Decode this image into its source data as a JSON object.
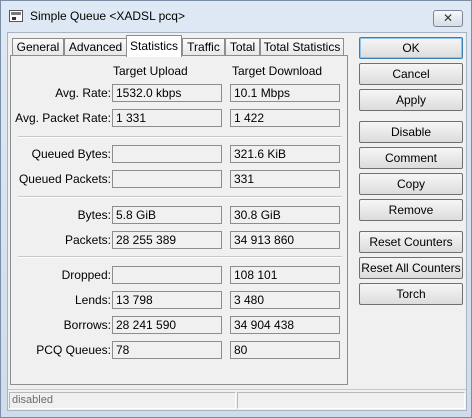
{
  "window": {
    "title": "Simple Queue <XADSL pcq>",
    "close_glyph": "✕"
  },
  "tabs": [
    {
      "label": "General",
      "active": false
    },
    {
      "label": "Advanced",
      "active": false
    },
    {
      "label": "Statistics",
      "active": true
    },
    {
      "label": "Traffic",
      "active": false
    },
    {
      "label": "Total",
      "active": false
    },
    {
      "label": "Total Statistics",
      "active": false
    }
  ],
  "stats": {
    "col_upload": "Target Upload",
    "col_download": "Target Download",
    "rows": [
      {
        "label": "Avg. Rate:",
        "upload": "1532.0 kbps",
        "download": "10.1 Mbps"
      },
      {
        "label": "Avg. Packet Rate:",
        "upload": "1 331",
        "download": "1 422"
      },
      {
        "label": "Queued Bytes:",
        "upload": "",
        "download": "321.6 KiB"
      },
      {
        "label": "Queued Packets:",
        "upload": "",
        "download": "331"
      },
      {
        "label": "Bytes:",
        "upload": "5.8 GiB",
        "download": "30.8 GiB"
      },
      {
        "label": "Packets:",
        "upload": "28 255 389",
        "download": "34 913 860"
      },
      {
        "label": "Dropped:",
        "upload": "",
        "download": "108 101"
      },
      {
        "label": "Lends:",
        "upload": "13 798",
        "download": "3 480"
      },
      {
        "label": "Borrows:",
        "upload": "28 241 590",
        "download": "34 904 438"
      },
      {
        "label": "PCQ Queues:",
        "upload": "78",
        "download": "80"
      }
    ]
  },
  "buttons": {
    "ok": "OK",
    "cancel": "Cancel",
    "apply": "Apply",
    "disable": "Disable",
    "comment": "Comment",
    "copy": "Copy",
    "remove": "Remove",
    "reset_counters": "Reset Counters",
    "reset_all_counters": "Reset All Counters",
    "torch": "Torch"
  },
  "status": {
    "state": "disabled",
    "secondary": ""
  }
}
